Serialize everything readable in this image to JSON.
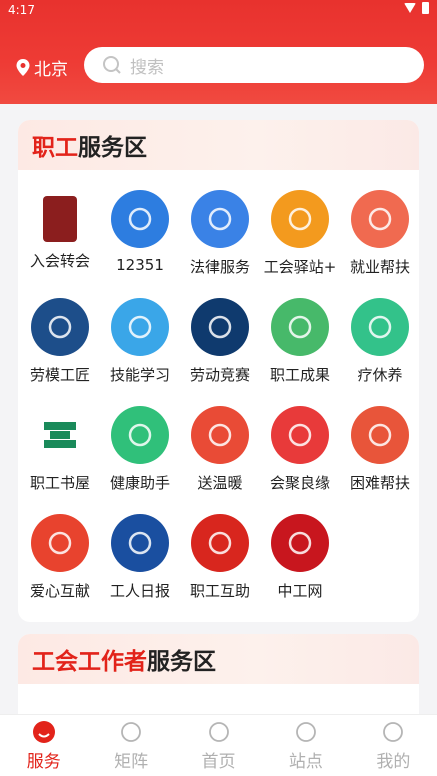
{
  "status": {
    "time": "4:17"
  },
  "header": {
    "city": "北京",
    "search_placeholder": "搜索"
  },
  "section1": {
    "title_highlight": "职工",
    "title_rest": "服务区",
    "items": [
      {
        "label": "入会转会",
        "icon": "membership-book-icon",
        "color": "#8b1e1e"
      },
      {
        "label": "12351",
        "icon": "hotline-12351-icon",
        "color": "#2d7de0"
      },
      {
        "label": "法律服务",
        "icon": "scales-icon",
        "color": "#3a82e6"
      },
      {
        "label": "工会驿站+",
        "icon": "station-house-icon",
        "color": "#f39a1e"
      },
      {
        "label": "就业帮扶",
        "icon": "job-resume-icon",
        "color": "#f06a50"
      },
      {
        "label": "劳模工匠",
        "icon": "model-worker-badge-icon",
        "color": "#1d4e8a"
      },
      {
        "label": "技能学习",
        "icon": "worker-helmet-icon",
        "color": "#3aa6e8"
      },
      {
        "label": "劳动竞赛",
        "icon": "competition-pattern-icon",
        "color": "#0f3a6e"
      },
      {
        "label": "职工成果",
        "icon": "growth-tree-icon",
        "color": "#47b96a"
      },
      {
        "label": "疗休养",
        "icon": "palm-tree-icon",
        "color": "#33c28a"
      },
      {
        "label": "职工书屋",
        "icon": "bookstore-icon",
        "color": "#1a9a6a"
      },
      {
        "label": "健康助手",
        "icon": "nurse-cap-icon",
        "color": "#30c07a"
      },
      {
        "label": "送温暖",
        "icon": "heart-hand-icon",
        "color": "#e94b36"
      },
      {
        "label": "会聚良缘",
        "icon": "couple-heart-icon",
        "color": "#e83a3a"
      },
      {
        "label": "困难帮扶",
        "icon": "helping-heart-icon",
        "color": "#e8553a"
      },
      {
        "label": "爱心互献",
        "icon": "love-donate-icon",
        "color": "#e8432e"
      },
      {
        "label": "工人日报",
        "icon": "workers-daily-icon",
        "color": "#1a4fa0"
      },
      {
        "label": "职工互助",
        "icon": "mutual-aid-emblem-icon",
        "color": "#d8261e"
      },
      {
        "label": "中工网",
        "icon": "workercn-logo-icon",
        "color": "#c8161e"
      }
    ]
  },
  "section2": {
    "title_highlight": "工会工作者",
    "title_rest": "服务区"
  },
  "tabs": [
    {
      "label": "服务",
      "active": true,
      "icon": "service-icon"
    },
    {
      "label": "矩阵",
      "active": false,
      "icon": "building-icon"
    },
    {
      "label": "首页",
      "active": false,
      "icon": "home-icon"
    },
    {
      "label": "站点",
      "active": false,
      "icon": "location-icon"
    },
    {
      "label": "我的",
      "active": false,
      "icon": "profile-icon"
    }
  ]
}
